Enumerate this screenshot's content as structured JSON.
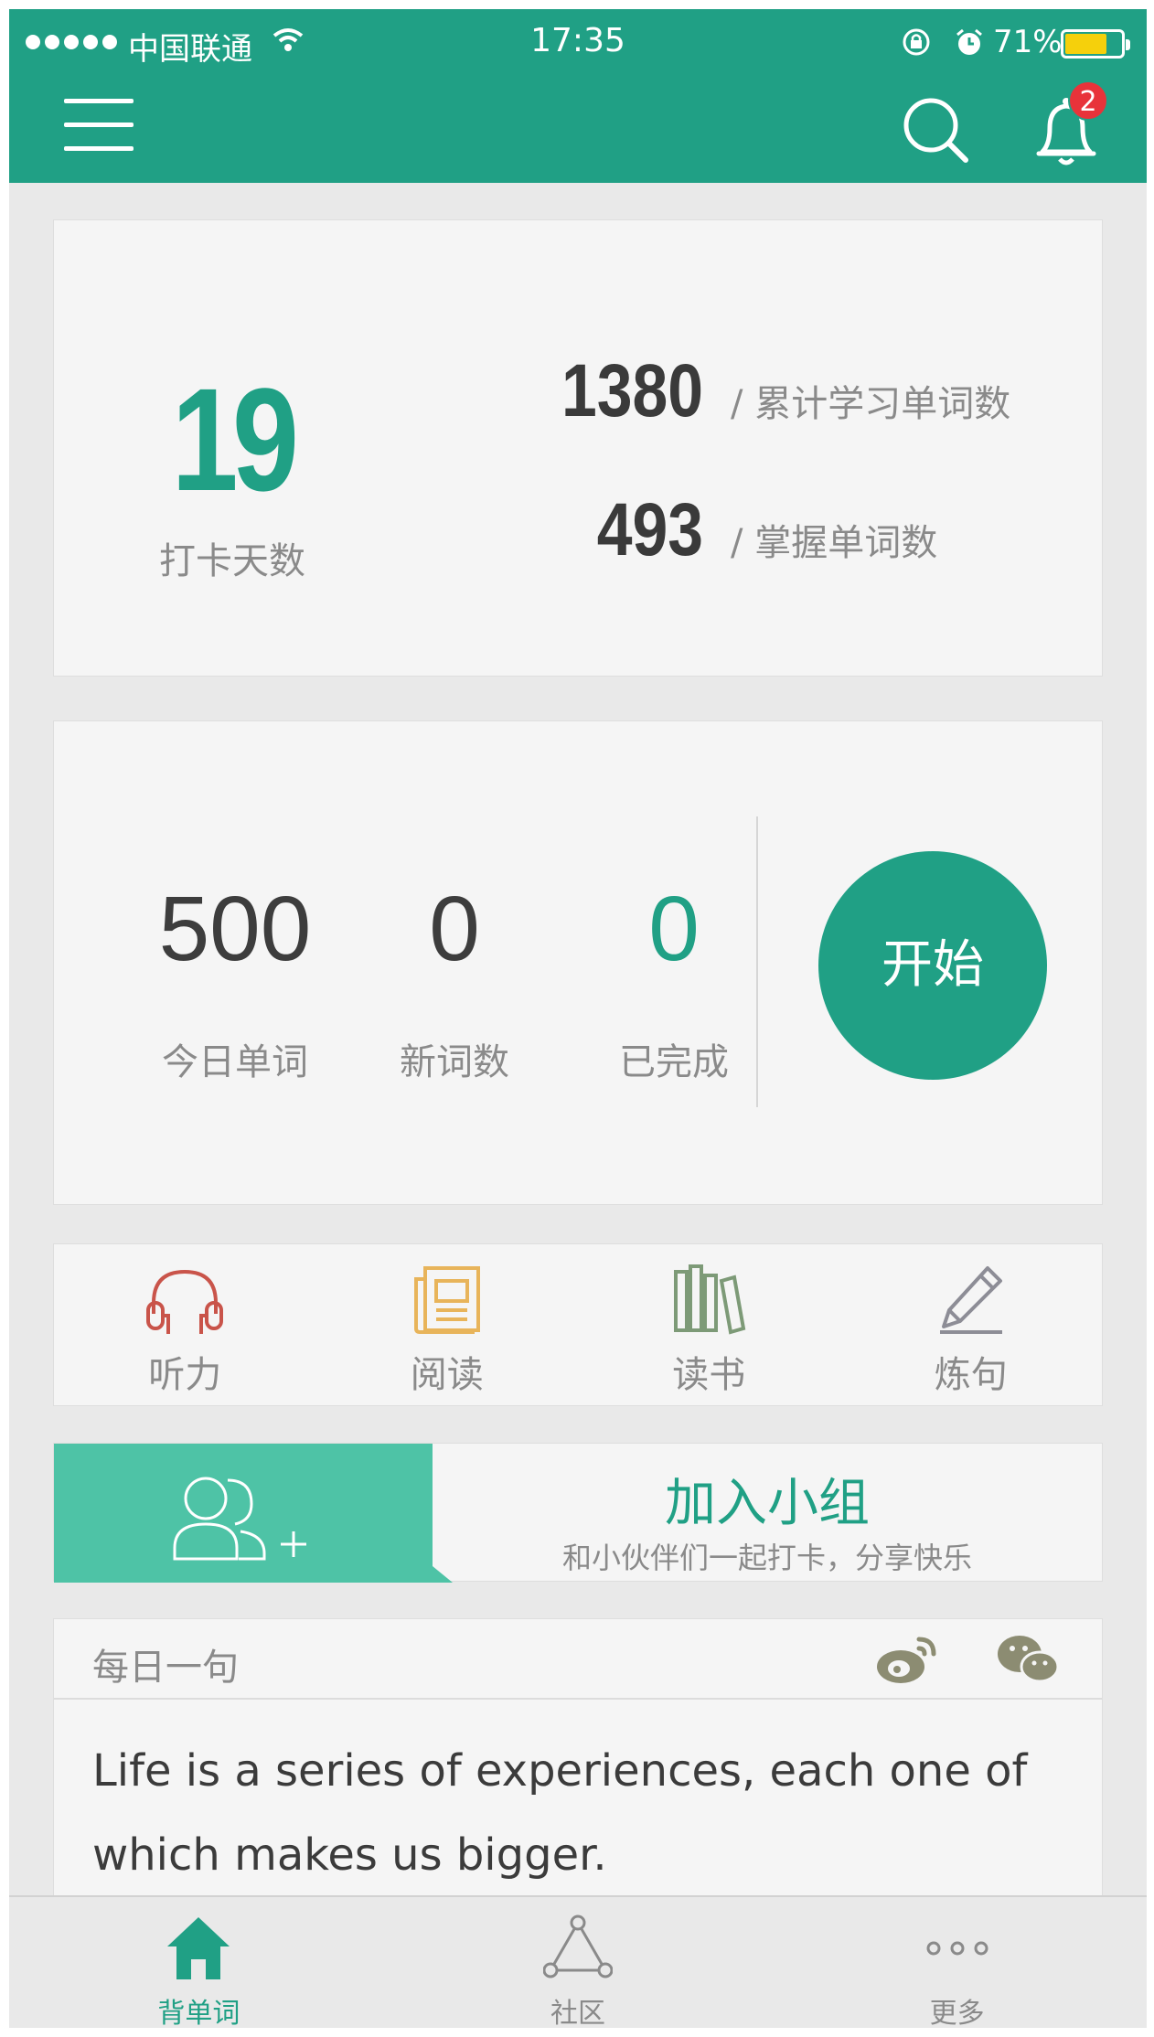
{
  "status_bar": {
    "carrier": "中国联通",
    "time": "17:35",
    "battery_percent": "71%",
    "battery_level": 0.71
  },
  "header": {
    "notification_count": "2",
    "colors": {
      "brand": "#20a085",
      "badge": "#e8333a"
    }
  },
  "stats": {
    "streak_days": "19",
    "streak_label": "打卡天数",
    "total_words": "1380",
    "total_words_label": "/ 累计学习单词数",
    "mastered_words": "493",
    "mastered_words_label": "/ 掌握单词数"
  },
  "plan": {
    "today_words": "500",
    "today_label": "今日单词",
    "new_words": "0",
    "new_label": "新词数",
    "done": "0",
    "done_label": "已完成",
    "start_label": "开始"
  },
  "tools": [
    {
      "label": "听力",
      "icon": "headphones-icon",
      "color": "#c9544a"
    },
    {
      "label": "阅读",
      "icon": "newspaper-icon",
      "color": "#e8b45a"
    },
    {
      "label": "读书",
      "icon": "books-icon",
      "color": "#7d9a77"
    },
    {
      "label": "炼句",
      "icon": "pencil-icon",
      "color": "#8d8d96"
    }
  ],
  "group": {
    "title": "加入小组",
    "subtitle": "和小伙伴们一起打卡，分享快乐"
  },
  "quote": {
    "title": "每日一句",
    "text": "Life is a series of experiences, each one of which makes us bigger."
  },
  "tabbar": [
    {
      "label": "背单词",
      "icon": "home-icon",
      "active": true
    },
    {
      "label": "社区",
      "icon": "community-icon",
      "active": false
    },
    {
      "label": "更多",
      "icon": "more-icon",
      "active": false
    }
  ]
}
